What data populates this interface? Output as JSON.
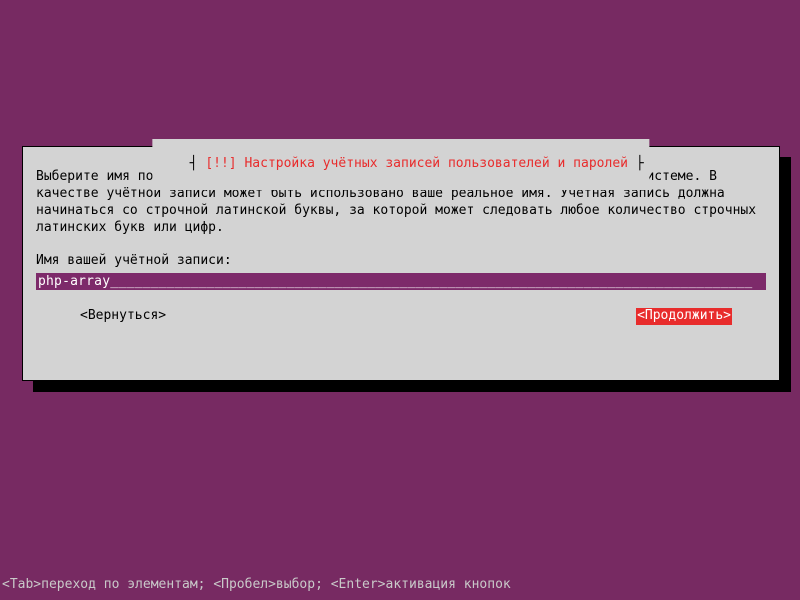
{
  "dialog": {
    "title_prefix": "┤ ",
    "title_marker": "[!!]",
    "title_text": " Настройка учётных записей пользователей и паролей ",
    "title_suffix": "├",
    "description": "Выберите имя пользователя (учётную запись), под которым вы будете известны в системе. В качестве учётной записи может быть использовано ваше реальное имя. Учётная запись должна начинаться со строчной латинской буквы, за которой может следовать любое количество строчных латинских букв или цифр.",
    "prompt": "Имя вашей учётной записи:",
    "input_value": "php-array________________________________________________________________________________",
    "back_label": "<Вернуться>",
    "continue_label": "<Продолжить>"
  },
  "statusbar": {
    "text": "<Tab>переход по элементам; <Пробел>выбор; <Enter>активация кнопок"
  }
}
